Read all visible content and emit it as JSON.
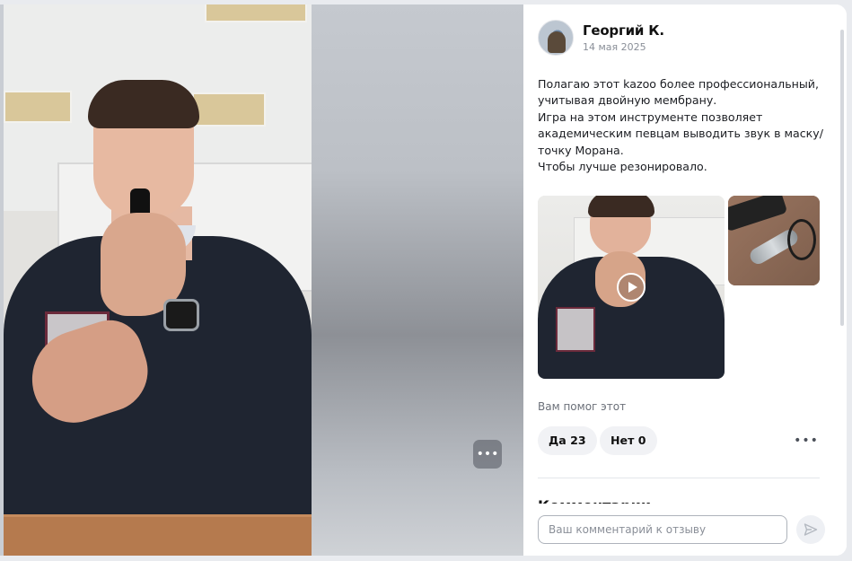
{
  "review": {
    "author": {
      "name": "Георгий К.",
      "date": "14 мая 2025",
      "avatar_icon": "user-avatar-photo"
    },
    "text_lines": [
      "Полагаю этот kazoo более профессиональный,",
      "учитывая двойную мембрану.",
      "Игра на этом инструменте позволяет",
      "академическим певцам выводить звук в маску/",
      "точку Морана.",
      "Чтобы лучше резонировало."
    ],
    "attachments": [
      {
        "kind": "video",
        "icon": "play-icon"
      },
      {
        "kind": "photo"
      }
    ],
    "helpful": {
      "question": "Вам помог этот",
      "yes_label": "Да 23",
      "no_label": "Нет 0",
      "yes_count": 23,
      "no_count": 0
    }
  },
  "media": {
    "more_icon": "more-horizontal-icon",
    "more_glyph": "•••"
  },
  "panel": {
    "more_glyph": "•••",
    "comments_heading": "Комментарии"
  },
  "comment": {
    "placeholder": "Ваш комментарий к отзыву",
    "value": "",
    "send_icon": "send-icon"
  },
  "colors": {
    "accent_text": "#111111",
    "muted_text": "#8a8f98",
    "chip_bg": "#f1f2f5",
    "input_border": "#aeb3bb"
  }
}
